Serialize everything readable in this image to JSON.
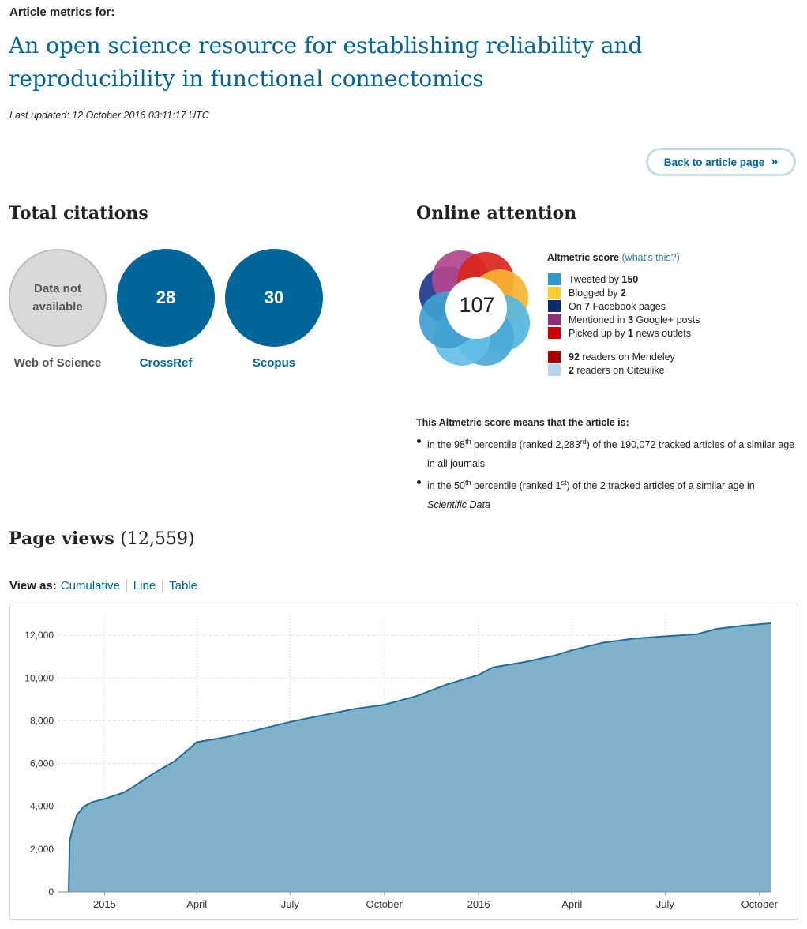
{
  "header": {
    "kicker": "Article metrics for:",
    "title": "An open science resource for establishing reliability and reproducibility in functional connectomics",
    "last_updated": "Last updated: 12 October 2016 03:11:17 UTC",
    "back_button": "Back to article page",
    "back_icon": "double-chevron-right-icon"
  },
  "citations": {
    "heading": "Total citations",
    "items": [
      {
        "value": "Data not\navailable",
        "label": "Web of Science"
      },
      {
        "value": "28",
        "label": "CrossRef"
      },
      {
        "value": "30",
        "label": "Scopus"
      }
    ]
  },
  "attention": {
    "heading": "Online attention",
    "score": "107",
    "score_label": "Altmetric score",
    "whats_this": "(what's this?)",
    "sources": [
      {
        "color": "#3399cc",
        "pre": "Tweeted by ",
        "num": "150",
        "post": ""
      },
      {
        "color": "#ffcc33",
        "pre": "Blogged by ",
        "num": "2",
        "post": ""
      },
      {
        "color": "#0b2a70",
        "pre": "On ",
        "num": "7",
        "post": " Facebook pages"
      },
      {
        "color": "#8e2e73",
        "pre": "Mentioned in ",
        "num": "3",
        "post": " Google+ posts"
      },
      {
        "color": "#cc0000",
        "pre": "Picked up by ",
        "num": "1",
        "post": " news outlets"
      }
    ],
    "readers": [
      {
        "color": "#a60000",
        "pre": "",
        "num": "92",
        "post": " readers on Mendeley"
      },
      {
        "color": "#b8d4ef",
        "pre": "",
        "num": "2",
        "post": " readers on Citeulike"
      }
    ],
    "means_heading": "This Altmetric score means that the article is:",
    "percentile_1": {
      "pre": "in the 98",
      "sup1": "th",
      "mid": " percentile (ranked 2,283",
      "sup2": "rd",
      "post": ") of the 190,072 tracked articles of a similar age in all journals"
    },
    "percentile_2": {
      "pre": "in the 50",
      "sup1": "th",
      "mid": " percentile (ranked 1",
      "sup2": "st",
      "post": ") of the 2 tracked articles of a similar age in ",
      "journal": "Scientific Data"
    }
  },
  "page_views": {
    "heading": "Page views",
    "count": "(12,559)",
    "view_as_label": "View as:",
    "view_options": [
      "Cumulative",
      "Line",
      "Table"
    ]
  },
  "colors": {
    "accent": "#006699",
    "area_fill": "#80b2cc",
    "area_line": "#1f6f9b"
  },
  "chart_data": {
    "type": "area",
    "title": "",
    "xlabel": "",
    "ylabel": "",
    "ylim": [
      0,
      12000
    ],
    "yticks": [
      0,
      2000,
      4000,
      6000,
      8000,
      10000,
      12000
    ],
    "ytick_labels": [
      "0",
      "2,000",
      "4,000",
      "6,000",
      "8,000",
      "10,000",
      "12,000"
    ],
    "xticks": [
      "2015-01-01",
      "2015-04-01",
      "2015-07-01",
      "2015-10-01",
      "2016-01-01",
      "2016-04-01",
      "2016-07-01",
      "2016-10-01"
    ],
    "xtick_labels": [
      "2015",
      "April",
      "July",
      "October",
      "2016",
      "April",
      "July",
      "October"
    ],
    "xlim": [
      "2014-11-17",
      "2016-10-12"
    ],
    "grid": true,
    "legend": "none",
    "series": [
      {
        "values": [
          {
            "x": "2014-11-27",
            "y": 0
          },
          {
            "x": "2014-11-28",
            "y": 2400
          },
          {
            "x": "2014-12-01",
            "y": 3000
          },
          {
            "x": "2014-12-05",
            "y": 3600
          },
          {
            "x": "2014-12-12",
            "y": 4000
          },
          {
            "x": "2014-12-20",
            "y": 4200
          },
          {
            "x": "2015-01-01",
            "y": 4350
          },
          {
            "x": "2015-01-20",
            "y": 4650
          },
          {
            "x": "2015-02-01",
            "y": 5000
          },
          {
            "x": "2015-02-10",
            "y": 5300
          },
          {
            "x": "2015-02-20",
            "y": 5600
          },
          {
            "x": "2015-03-01",
            "y": 5850
          },
          {
            "x": "2015-03-10",
            "y": 6100
          },
          {
            "x": "2015-03-20",
            "y": 6500
          },
          {
            "x": "2015-04-01",
            "y": 7000
          },
          {
            "x": "2015-05-01",
            "y": 7250
          },
          {
            "x": "2015-06-01",
            "y": 7600
          },
          {
            "x": "2015-07-01",
            "y": 7950
          },
          {
            "x": "2015-08-01",
            "y": 8250
          },
          {
            "x": "2015-09-01",
            "y": 8550
          },
          {
            "x": "2015-10-01",
            "y": 8750
          },
          {
            "x": "2015-11-01",
            "y": 9150
          },
          {
            "x": "2015-12-01",
            "y": 9700
          },
          {
            "x": "2016-01-01",
            "y": 10150
          },
          {
            "x": "2016-01-15",
            "y": 10500
          },
          {
            "x": "2016-02-15",
            "y": 10750
          },
          {
            "x": "2016-03-15",
            "y": 11050
          },
          {
            "x": "2016-04-01",
            "y": 11300
          },
          {
            "x": "2016-05-01",
            "y": 11650
          },
          {
            "x": "2016-06-01",
            "y": 11850
          },
          {
            "x": "2016-07-01",
            "y": 11950
          },
          {
            "x": "2016-08-01",
            "y": 12050
          },
          {
            "x": "2016-08-20",
            "y": 12300
          },
          {
            "x": "2016-09-15",
            "y": 12450
          },
          {
            "x": "2016-10-12",
            "y": 12559
          }
        ]
      }
    ]
  }
}
